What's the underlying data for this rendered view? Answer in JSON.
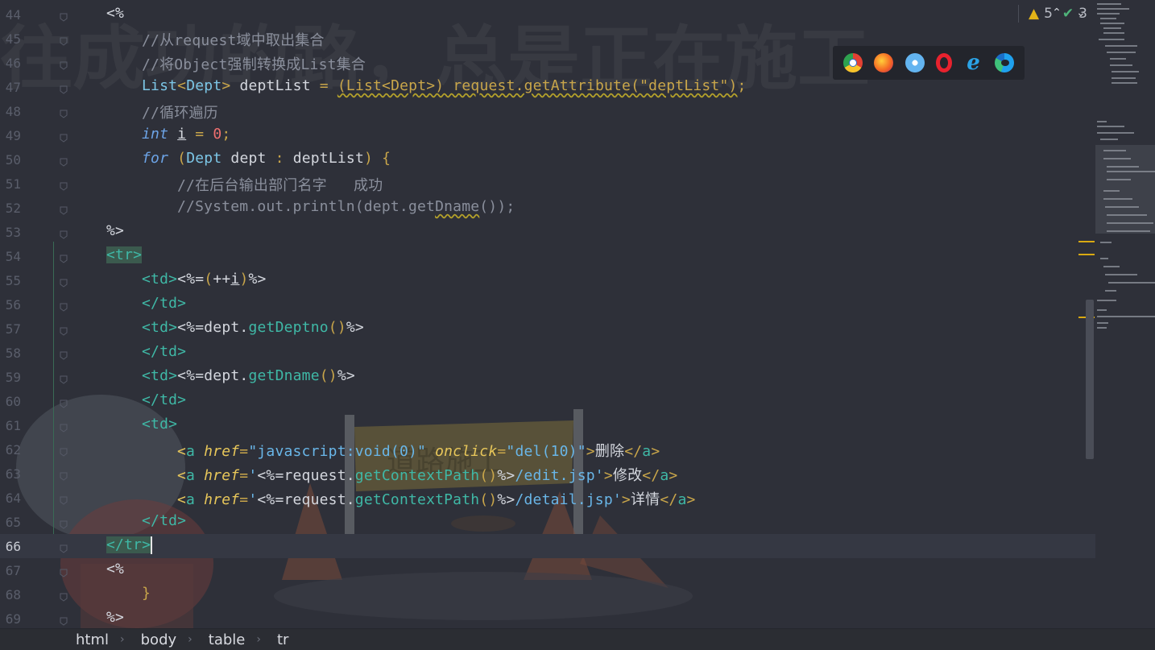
{
  "top_bar": {
    "warnings_count": "5",
    "checks_count": "3",
    "prev_icon": "chevron-up-icon",
    "next_icon": "chevron-down-icon"
  },
  "browser_icons": [
    "chrome-icon",
    "firefox-icon",
    "safari-icon",
    "opera-icon",
    "ie-icon",
    "edge-icon"
  ],
  "background_text": "往成功的路，总是正在施工",
  "current_line": "66",
  "lines": [
    {
      "n": "44",
      "segs": [
        {
          "c": "t",
          "x": "<%"
        }
      ],
      "indent": 132
    },
    {
      "n": "45",
      "segs": [
        {
          "c": "cm",
          "x": "//从request域中取出集合"
        }
      ],
      "indent": 176
    },
    {
      "n": "46",
      "segs": [
        {
          "c": "cm",
          "x": "//将Object强制转换成List集合"
        }
      ],
      "indent": 176
    },
    {
      "n": "47",
      "segs": [
        {
          "c": "ty",
          "x": "List"
        },
        {
          "c": "pun",
          "x": "<"
        },
        {
          "c": "ty",
          "x": "Dept"
        },
        {
          "c": "pun",
          "x": ">"
        },
        {
          "c": "t",
          "x": " deptList "
        },
        {
          "c": "pun",
          "x": "="
        },
        {
          "c": "t",
          "x": " "
        },
        {
          "c": "pun warn-ul",
          "x": "(List<Dept>) request.getAttribute(\"deptList\")"
        },
        {
          "c": "pun",
          "x": ";"
        }
      ],
      "indent": 176
    },
    {
      "n": "48",
      "segs": [
        {
          "c": "cm",
          "x": "//循环遍历"
        }
      ],
      "indent": 176
    },
    {
      "n": "49",
      "segs": [
        {
          "c": "kw",
          "x": "int"
        },
        {
          "c": "t",
          "x": " "
        },
        {
          "c": "t ul",
          "x": "i"
        },
        {
          "c": "t",
          "x": " "
        },
        {
          "c": "pun",
          "x": "="
        },
        {
          "c": "t",
          "x": " "
        },
        {
          "c": "num",
          "x": "0"
        },
        {
          "c": "pun",
          "x": ";"
        }
      ],
      "indent": 176
    },
    {
      "n": "50",
      "segs": [
        {
          "c": "kw",
          "x": "for"
        },
        {
          "c": "t",
          "x": " "
        },
        {
          "c": "pun",
          "x": "("
        },
        {
          "c": "ty",
          "x": "Dept"
        },
        {
          "c": "t",
          "x": " dept "
        },
        {
          "c": "pun",
          "x": ":"
        },
        {
          "c": "t",
          "x": " deptList"
        },
        {
          "c": "pun",
          "x": ")"
        },
        {
          "c": "t",
          "x": " "
        },
        {
          "c": "pun",
          "x": "{"
        }
      ],
      "indent": 176
    },
    {
      "n": "51",
      "segs": [
        {
          "c": "cm",
          "x": "//在后台输出部门名字   成功"
        }
      ],
      "indent": 220
    },
    {
      "n": "52",
      "segs": [
        {
          "c": "cm",
          "x": "//System.out.println(dept.get"
        },
        {
          "c": "cm warn-ul",
          "x": "Dname"
        },
        {
          "c": "cm",
          "x": "());"
        }
      ],
      "indent": 220
    },
    {
      "n": "53",
      "segs": [
        {
          "c": "t",
          "x": "%>"
        }
      ],
      "indent": 132
    },
    {
      "n": "54",
      "segs": [
        {
          "c": "tag tr-hl",
          "x": "<tr>"
        }
      ],
      "indent": 132
    },
    {
      "n": "55",
      "segs": [
        {
          "c": "tag",
          "x": "<td>"
        },
        {
          "c": "t",
          "x": "<%="
        },
        {
          "c": "pun",
          "x": "("
        },
        {
          "c": "t",
          "x": "++"
        },
        {
          "c": "t ul",
          "x": "i"
        },
        {
          "c": "pun",
          "x": ")"
        },
        {
          "c": "t",
          "x": "%>"
        }
      ],
      "indent": 176
    },
    {
      "n": "56",
      "segs": [
        {
          "c": "tag",
          "x": "</td>"
        }
      ],
      "indent": 176
    },
    {
      "n": "57",
      "segs": [
        {
          "c": "tag",
          "x": "<td>"
        },
        {
          "c": "t",
          "x": "<%=dept."
        },
        {
          "c": "mth",
          "x": "getDeptno"
        },
        {
          "c": "pun",
          "x": "()"
        },
        {
          "c": "t",
          "x": "%>"
        }
      ],
      "indent": 176
    },
    {
      "n": "58",
      "segs": [
        {
          "c": "tag",
          "x": "</td>"
        }
      ],
      "indent": 176
    },
    {
      "n": "59",
      "segs": [
        {
          "c": "tag",
          "x": "<td>"
        },
        {
          "c": "t",
          "x": "<%=dept."
        },
        {
          "c": "mth",
          "x": "getDname"
        },
        {
          "c": "pun",
          "x": "()"
        },
        {
          "c": "t",
          "x": "%>"
        }
      ],
      "indent": 176
    },
    {
      "n": "60",
      "segs": [
        {
          "c": "tag",
          "x": "</td>"
        }
      ],
      "indent": 176
    },
    {
      "n": "61",
      "segs": [
        {
          "c": "tag",
          "x": "<td>"
        }
      ],
      "indent": 176
    },
    {
      "n": "62",
      "segs": [
        {
          "c": "attr",
          "x": "<"
        },
        {
          "c": "tag",
          "x": "a "
        },
        {
          "c": "attr",
          "x": "href"
        },
        {
          "c": "pun",
          "x": "="
        },
        {
          "c": "str",
          "x": "\"javascript:void(0)\" "
        },
        {
          "c": "attr",
          "x": "onclick"
        },
        {
          "c": "pun",
          "x": "="
        },
        {
          "c": "str",
          "x": "\"del(10)\""
        },
        {
          "c": "pun",
          "x": ">"
        },
        {
          "c": "t",
          "x": "删除"
        },
        {
          "c": "pun",
          "x": "</"
        },
        {
          "c": "tag",
          "x": "a"
        },
        {
          "c": "pun",
          "x": ">"
        }
      ],
      "indent": 220
    },
    {
      "n": "63",
      "segs": [
        {
          "c": "attr",
          "x": "<"
        },
        {
          "c": "tag",
          "x": "a "
        },
        {
          "c": "attr",
          "x": "href"
        },
        {
          "c": "pun",
          "x": "="
        },
        {
          "c": "str",
          "x": "'"
        },
        {
          "c": "t",
          "x": "<%=request."
        },
        {
          "c": "mth",
          "x": "getContextPath"
        },
        {
          "c": "pun",
          "x": "()"
        },
        {
          "c": "t",
          "x": "%>"
        },
        {
          "c": "str",
          "x": "/edit.jsp'"
        },
        {
          "c": "pun",
          "x": ">"
        },
        {
          "c": "t",
          "x": "修改"
        },
        {
          "c": "pun",
          "x": "</"
        },
        {
          "c": "tag",
          "x": "a"
        },
        {
          "c": "pun",
          "x": ">"
        }
      ],
      "indent": 220
    },
    {
      "n": "64",
      "segs": [
        {
          "c": "attr",
          "x": "<"
        },
        {
          "c": "tag",
          "x": "a "
        },
        {
          "c": "attr",
          "x": "href"
        },
        {
          "c": "pun",
          "x": "="
        },
        {
          "c": "str",
          "x": "'"
        },
        {
          "c": "t",
          "x": "<%=request."
        },
        {
          "c": "mth",
          "x": "getContextPath"
        },
        {
          "c": "pun",
          "x": "()"
        },
        {
          "c": "t",
          "x": "%>"
        },
        {
          "c": "str",
          "x": "/detail.jsp'"
        },
        {
          "c": "pun",
          "x": ">"
        },
        {
          "c": "t",
          "x": "详情"
        },
        {
          "c": "pun",
          "x": "</"
        },
        {
          "c": "tag",
          "x": "a"
        },
        {
          "c": "pun",
          "x": ">"
        }
      ],
      "indent": 220
    },
    {
      "n": "65",
      "segs": [
        {
          "c": "tag",
          "x": "</td>"
        }
      ],
      "indent": 176
    },
    {
      "n": "66",
      "segs": [
        {
          "c": "tag tr-hl",
          "x": "</tr>"
        }
      ],
      "indent": 132,
      "cursor": true
    },
    {
      "n": "67",
      "segs": [
        {
          "c": "t",
          "x": "<%"
        }
      ],
      "indent": 132
    },
    {
      "n": "68",
      "segs": [
        {
          "c": "pun",
          "x": "}"
        }
      ],
      "indent": 176
    },
    {
      "n": "69",
      "segs": [
        {
          "c": "t",
          "x": "%>"
        }
      ],
      "indent": 132
    }
  ],
  "breadcrumb": [
    "html",
    "body",
    "table",
    "tr"
  ]
}
